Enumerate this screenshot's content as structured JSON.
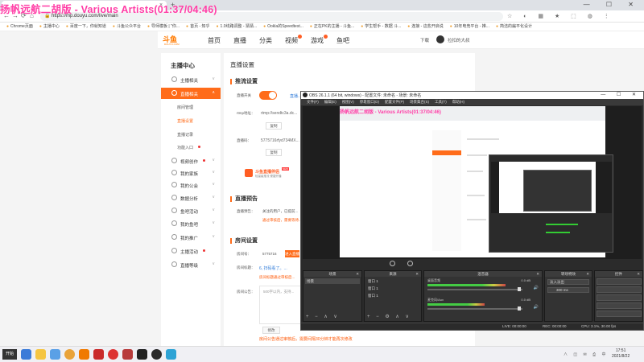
{
  "overlay_title": "扬帆远航二胡版 - Various Artists(01:37/04:46)",
  "browser": {
    "tab_close": "×",
    "new_tab": "+",
    "window_controls": "—  ☐  ✕",
    "nav": {
      "back": "←",
      "forward": "→",
      "reload": "⟳",
      "home": "⌂"
    },
    "url_lock": "🔒",
    "url": "https://mp.douyu.com/live/main",
    "extensions": "☆ ◐ ▦ ★ ⬚ ◍ ⋮",
    "bookmarks": [
      "Chrome页面",
      "主播中心",
      "百度一下，你就知道",
      "斗鱼公众平台",
      "导师模板 | \"你...",
      "首页 - 知乎",
      "1.0线路调整 - 猜猜...",
      "Ookla的Speedtest...",
      "正在PK的主播 - 斗鱼...",
      "学生帮手 - 数据 斗...",
      "连接 - 这些开启说",
      "10年电竞平台 - 推...",
      "简洁的扁平化设计"
    ]
  },
  "site": {
    "logo": "斗鱼",
    "logo_sub": "DOUYU.COM",
    "nav": [
      "首页",
      "直播",
      "分类",
      "视频",
      "游戏",
      "鱼吧"
    ],
    "download": "下载",
    "username": "拉扣的大叔"
  },
  "sidebar": {
    "title": "主播中心",
    "items": [
      {
        "label": "主播相关",
        "chev": "∨"
      },
      {
        "label": "直播相关",
        "chev": "∧"
      },
      {
        "label": "视频创作",
        "chev": "∨"
      },
      {
        "label": "我的家族",
        "chev": "∨"
      },
      {
        "label": "我的公会",
        "chev": "∨"
      },
      {
        "label": "数据分析",
        "chev": "∨"
      },
      {
        "label": "鱼吧活动",
        "chev": "∨"
      },
      {
        "label": "我的鱼吧",
        "chev": "∨"
      },
      {
        "label": "我的推广",
        "chev": "∨"
      },
      {
        "label": "主播活动",
        "chev": ""
      },
      {
        "label": "直播等级",
        "chev": "∨"
      }
    ],
    "subitems": [
      "房间管理",
      "直播设置",
      "直播记录",
      "功能入口"
    ]
  },
  "main": {
    "title": "直播设置",
    "stream": {
      "heading": "推流设置",
      "switch_label": "直播开关",
      "switch_on": true,
      "switch_link": "直播...",
      "rtmp_label": "rtmp地址：",
      "rtmp_value": "rtmp://sendtc3a.dc...",
      "copy1": "复制",
      "key_label": "直播码：",
      "key_value": "5775716rfyd734MX...",
      "copy2": "复制",
      "promo_title": "斗鱼直播伴侣",
      "promo_new": "NEW",
      "promo_sub": "轻量级推流 便捷开播",
      "notice_heading": "直播预告",
      "notice_label": "直播预告：",
      "notice_text": "关注的用户，已提前...",
      "notice_tip": "通过审核后，需要等待..."
    },
    "room": {
      "heading": "房间设置",
      "id_label": "房间号：",
      "id_value": "5775716",
      "enter_btn": "进入直播间",
      "title_label": "房间标题：",
      "title_value": "6, 扫码看了。...",
      "title_tip": "房间标题通过审核后...",
      "announce_label": "房间公告：",
      "announce_placeholder": "500字以内，支持...",
      "modify_btn": "修改",
      "bottom_note": "房间公告通过审核后，需要间隔30分钟才能再次修改"
    }
  },
  "obs": {
    "title": "OBS 26.1.1 (64 bit, windows) - 配置文件: 未命名 - 场景: 未命名",
    "window_controls": "—  ☐  ✕",
    "menu": [
      "文件(F)",
      "编辑(E)",
      "视图(V)",
      "停靠窗口(D)",
      "配置文件(P)",
      "场景集合(S)",
      "工具(T)",
      "帮助(H)"
    ],
    "docks": {
      "scenes": {
        "title": "场景",
        "close": "✕",
        "items": [
          "场景"
        ],
        "footer": "+ − ∧ ∨"
      },
      "sources": {
        "title": "来源",
        "close": "✕",
        "items": [
          "窗口 1",
          "窗口 1",
          "窗口 1"
        ],
        "footer": "+ − ⚙ ∧ ∨"
      },
      "mixer": {
        "title": "混音器",
        "close": "✕",
        "channels": [
          {
            "name": "桌面音频",
            "db": "0.0 dB",
            "level": 0.82
          },
          {
            "name": "麦克风/Aux",
            "db": "0.0 dB",
            "level": 0.6
          }
        ]
      },
      "transitions": {
        "title": "转场特效",
        "close": "✕",
        "type": "淡入淡出",
        "duration": "300 ms"
      },
      "controls": {
        "title": "控件",
        "close": "✕"
      }
    },
    "status": {
      "live": "LIVE: 00:00:00",
      "rec": "REC: 00:00:00",
      "cpu": "CPU: 3.1%, 30.00 fps"
    }
  },
  "taskbar": {
    "start": "开始",
    "tray": "∧ ◫ ✉ ⎙ 中",
    "time": "17:51",
    "date": "2021/8/22"
  }
}
